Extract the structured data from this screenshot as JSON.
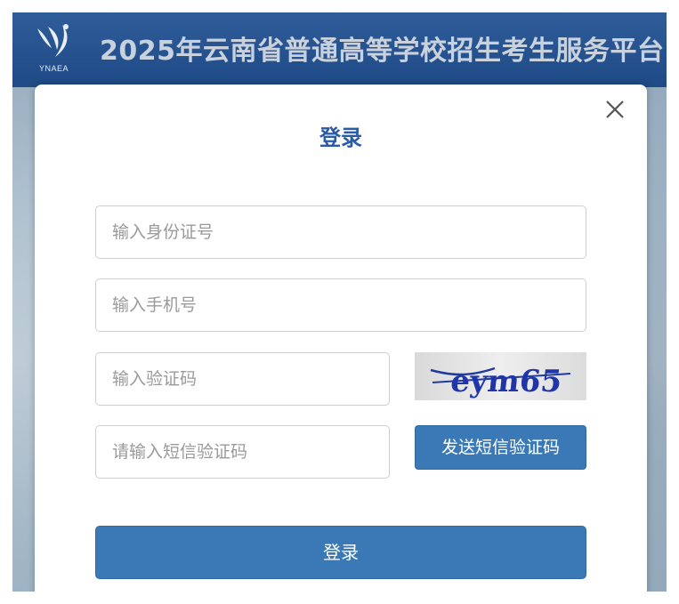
{
  "header": {
    "logo_text": "YNAEA",
    "title": "2025年云南省普通高等学校招生考生服务平台"
  },
  "dialog": {
    "title": "登录",
    "id_input": {
      "placeholder": "输入身份证号",
      "value": ""
    },
    "phone_input": {
      "placeholder": "输入手机号",
      "value": ""
    },
    "captcha_input": {
      "placeholder": "输入验证码",
      "value": ""
    },
    "captcha_text": "eym65",
    "sms_input": {
      "placeholder": "请输入短信验证码",
      "value": ""
    },
    "sms_button_label": "发送短信验证码",
    "login_button_label": "登录"
  },
  "colors": {
    "header_bg": "#1e4a86",
    "title_color": "#2a5ba6",
    "button_bg": "#3a79b6"
  },
  "icons": {
    "close": "close-icon",
    "logo": "ynaea-logo-icon"
  }
}
